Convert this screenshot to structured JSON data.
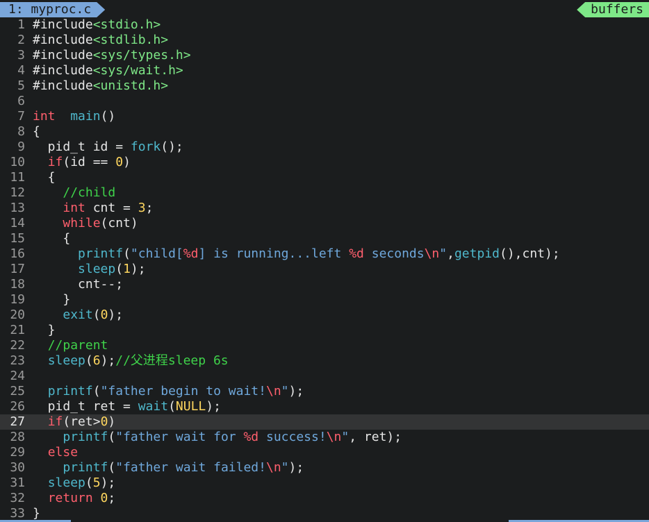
{
  "tabline": {
    "active_tab": "1: myproc.c",
    "right_label": "buffers"
  },
  "colors": {
    "background": "#1b1d1e",
    "tab_active": "#7aa6da",
    "buffers_label": "#7ee787",
    "keyword": "#ff5f6d",
    "function": "#4fb8cc",
    "string": "#6fa8dc",
    "number": "#ffd75f",
    "comment": "#3fd24a"
  },
  "editor": {
    "cursor_line": 27,
    "lines": [
      {
        "n": "1",
        "tokens": [
          [
            "pp",
            "#include"
          ],
          [
            "inc",
            "<stdio.h>"
          ]
        ]
      },
      {
        "n": "2",
        "tokens": [
          [
            "pp",
            "#include"
          ],
          [
            "inc",
            "<stdlib.h>"
          ]
        ]
      },
      {
        "n": "3",
        "tokens": [
          [
            "pp",
            "#include"
          ],
          [
            "inc",
            "<sys/types.h>"
          ]
        ]
      },
      {
        "n": "4",
        "tokens": [
          [
            "pp",
            "#include"
          ],
          [
            "inc",
            "<sys/wait.h>"
          ]
        ]
      },
      {
        "n": "5",
        "tokens": [
          [
            "pp",
            "#include"
          ],
          [
            "inc",
            "<unistd.h>"
          ]
        ]
      },
      {
        "n": "6",
        "tokens": []
      },
      {
        "n": "7",
        "tokens": [
          [
            "kw",
            "int"
          ],
          [
            "",
            "  "
          ],
          [
            "fn",
            "main"
          ],
          [
            "",
            "()"
          ]
        ]
      },
      {
        "n": "8",
        "tokens": [
          [
            "",
            "{"
          ]
        ]
      },
      {
        "n": "9",
        "tokens": [
          [
            "",
            "  pid_t id = "
          ],
          [
            "fn",
            "fork"
          ],
          [
            "",
            "();"
          ]
        ]
      },
      {
        "n": "10",
        "tokens": [
          [
            "",
            "  "
          ],
          [
            "kw",
            "if"
          ],
          [
            "",
            "(id == "
          ],
          [
            "num",
            "0"
          ],
          [
            "",
            ")"
          ]
        ]
      },
      {
        "n": "11",
        "tokens": [
          [
            "",
            "  {"
          ]
        ]
      },
      {
        "n": "12",
        "tokens": [
          [
            "",
            "    "
          ],
          [
            "cm",
            "//child"
          ]
        ]
      },
      {
        "n": "13",
        "tokens": [
          [
            "",
            "    "
          ],
          [
            "kw",
            "int"
          ],
          [
            "",
            " cnt = "
          ],
          [
            "num",
            "3"
          ],
          [
            "",
            ";"
          ]
        ]
      },
      {
        "n": "14",
        "tokens": [
          [
            "",
            "    "
          ],
          [
            "kw",
            "while"
          ],
          [
            "",
            "(cnt)"
          ]
        ]
      },
      {
        "n": "15",
        "tokens": [
          [
            "",
            "    {"
          ]
        ]
      },
      {
        "n": "16",
        "tokens": [
          [
            "",
            "      "
          ],
          [
            "fn",
            "printf"
          ],
          [
            "",
            "("
          ],
          [
            "str",
            "\"child["
          ],
          [
            "esc",
            "%d"
          ],
          [
            "str",
            "] is running...left "
          ],
          [
            "esc",
            "%d"
          ],
          [
            "str",
            " seconds"
          ],
          [
            "esc",
            "\\n"
          ],
          [
            "str",
            "\""
          ],
          [
            "",
            ","
          ],
          [
            "fn",
            "getpid"
          ],
          [
            "",
            "(),cnt);"
          ]
        ]
      },
      {
        "n": "17",
        "tokens": [
          [
            "",
            "      "
          ],
          [
            "fn",
            "sleep"
          ],
          [
            "",
            "("
          ],
          [
            "num",
            "1"
          ],
          [
            "",
            ");"
          ]
        ]
      },
      {
        "n": "18",
        "tokens": [
          [
            "",
            "      cnt--;"
          ]
        ]
      },
      {
        "n": "19",
        "tokens": [
          [
            "",
            "    }"
          ]
        ]
      },
      {
        "n": "20",
        "tokens": [
          [
            "",
            "    "
          ],
          [
            "fn",
            "exit"
          ],
          [
            "",
            "("
          ],
          [
            "num",
            "0"
          ],
          [
            "",
            ");"
          ]
        ]
      },
      {
        "n": "21",
        "tokens": [
          [
            "",
            "  }"
          ]
        ]
      },
      {
        "n": "22",
        "tokens": [
          [
            "",
            "  "
          ],
          [
            "cm",
            "//parent"
          ]
        ]
      },
      {
        "n": "23",
        "tokens": [
          [
            "",
            "  "
          ],
          [
            "fn",
            "sleep"
          ],
          [
            "",
            "("
          ],
          [
            "num",
            "6"
          ],
          [
            "",
            ");"
          ],
          [
            "cm",
            "//父进程sleep 6s"
          ]
        ]
      },
      {
        "n": "24",
        "tokens": []
      },
      {
        "n": "25",
        "tokens": [
          [
            "",
            "  "
          ],
          [
            "fn",
            "printf"
          ],
          [
            "",
            "("
          ],
          [
            "str",
            "\"father begin to wait!"
          ],
          [
            "esc",
            "\\n"
          ],
          [
            "str",
            "\""
          ],
          [
            "",
            ");"
          ]
        ]
      },
      {
        "n": "26",
        "tokens": [
          [
            "",
            "  pid_t ret = "
          ],
          [
            "fn",
            "wait"
          ],
          [
            "",
            "("
          ],
          [
            "num",
            "NULL"
          ],
          [
            "",
            ");"
          ]
        ]
      },
      {
        "n": "27",
        "tokens": [
          [
            "",
            "  "
          ],
          [
            "kw",
            "if"
          ],
          [
            "",
            "(ret>"
          ],
          [
            "num",
            "0"
          ],
          [
            "",
            ")"
          ]
        ]
      },
      {
        "n": "28",
        "tokens": [
          [
            "",
            "    "
          ],
          [
            "fn",
            "printf"
          ],
          [
            "",
            "("
          ],
          [
            "str",
            "\"father wait for "
          ],
          [
            "esc",
            "%d"
          ],
          [
            "str",
            " success!"
          ],
          [
            "esc",
            "\\n"
          ],
          [
            "str",
            "\""
          ],
          [
            "",
            ", ret);"
          ]
        ]
      },
      {
        "n": "29",
        "tokens": [
          [
            "",
            "  "
          ],
          [
            "kw",
            "else"
          ]
        ]
      },
      {
        "n": "30",
        "tokens": [
          [
            "",
            "    "
          ],
          [
            "fn",
            "printf"
          ],
          [
            "",
            "("
          ],
          [
            "str",
            "\"father wait failed!"
          ],
          [
            "esc",
            "\\n"
          ],
          [
            "str",
            "\""
          ],
          [
            "",
            ");"
          ]
        ]
      },
      {
        "n": "31",
        "tokens": [
          [
            "",
            "  "
          ],
          [
            "fn",
            "sleep"
          ],
          [
            "",
            "("
          ],
          [
            "num",
            "5"
          ],
          [
            "",
            ");"
          ]
        ]
      },
      {
        "n": "32",
        "tokens": [
          [
            "",
            "  "
          ],
          [
            "kw",
            "return"
          ],
          [
            "",
            ""
          ],
          [
            "num",
            " 0"
          ],
          [
            "",
            ";"
          ]
        ]
      },
      {
        "n": "33",
        "tokens": [
          [
            "",
            "}"
          ]
        ]
      }
    ]
  }
}
